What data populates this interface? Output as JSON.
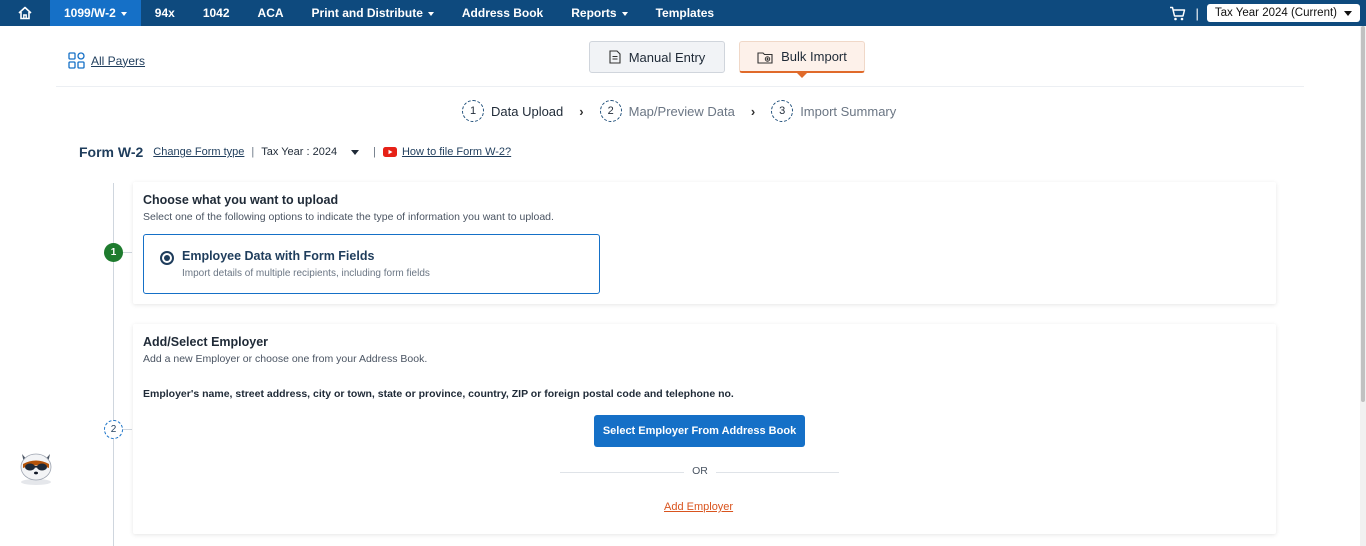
{
  "nav": {
    "items": [
      {
        "label": "1099/W-2",
        "has_caret": true,
        "active": true
      },
      {
        "label": "94x",
        "has_caret": false,
        "active": false
      },
      {
        "label": "1042",
        "has_caret": false,
        "active": false
      },
      {
        "label": "ACA",
        "has_caret": false,
        "active": false
      },
      {
        "label": "Print and Distribute",
        "has_caret": true,
        "active": false
      },
      {
        "label": "Address Book",
        "has_caret": false,
        "active": false
      },
      {
        "label": "Reports",
        "has_caret": true,
        "active": false
      },
      {
        "label": "Templates",
        "has_caret": false,
        "active": false
      }
    ],
    "separator": "|",
    "tax_year_select": "Tax Year 2024 (Current)"
  },
  "header": {
    "all_payers": "All Payers",
    "tabs": {
      "manual": "Manual Entry",
      "bulk": "Bulk Import"
    }
  },
  "steps": [
    {
      "num": "1",
      "label": "Data Upload"
    },
    {
      "num": "2",
      "label": "Map/Preview Data"
    },
    {
      "num": "3",
      "label": "Import Summary"
    }
  ],
  "form_row": {
    "title": "Form W-2",
    "change_type": "Change Form type",
    "sep": "|",
    "tax_year": "Tax Year : 2024",
    "how_to": "How to file Form W-2?"
  },
  "section1": {
    "marker": "1",
    "title": "Choose what you want to upload",
    "subtitle": "Select one of the following options to indicate the type of information you want to upload.",
    "option_title": "Employee Data with Form Fields",
    "option_sub": "Import details of multiple recipients, including form fields"
  },
  "section2": {
    "marker": "2",
    "title": "Add/Select Employer",
    "subtitle": "Add a new Employer or choose one from your Address Book.",
    "note": "Employer's name, street address, city or town, state or province, country, ZIP or foreign postal code and telephone no.",
    "select_button": "Select Employer From Address Book",
    "or": "OR",
    "add_link": "Add Employer"
  },
  "colors": {
    "nav_bg": "#0e4a7e",
    "nav_active": "#1570c7",
    "primary": "#1570c7",
    "accent": "#e06a2a",
    "success": "#1e7b2e"
  }
}
